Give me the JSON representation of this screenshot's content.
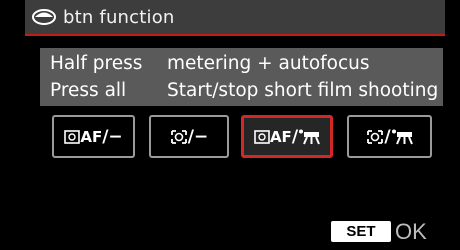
{
  "header": {
    "title": "btn function",
    "icon": "metering-icon"
  },
  "info": {
    "rows": [
      {
        "label": "Half press",
        "value": "metering + autofocus"
      },
      {
        "label": "Press all",
        "value": "Start/stop short film shooting"
      }
    ]
  },
  "options": [
    {
      "af": "AF",
      "sep": "/−",
      "selected": false,
      "icon": "metering-af-none-icon"
    },
    {
      "af": "",
      "sep": "/−",
      "selected": false,
      "icon": "metering-none-icon"
    },
    {
      "af": "AF",
      "sep": "/",
      "selected": true,
      "icon": "metering-af-movie-icon"
    },
    {
      "af": "",
      "sep": "/",
      "selected": false,
      "icon": "metering-movie-icon"
    }
  ],
  "footer": {
    "set": "SET",
    "ok": "OK"
  },
  "colors": {
    "accent": "#c11c1c",
    "header_bg": "#3d3d3d",
    "info_bg": "#5a5a5a"
  }
}
